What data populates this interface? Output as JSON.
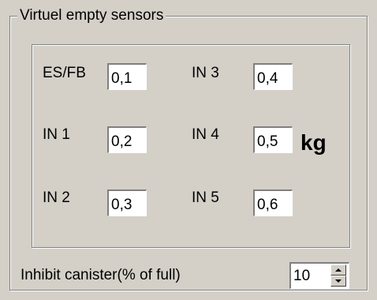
{
  "group": {
    "title": "Virtuel empty sensors"
  },
  "sensors": [
    {
      "label": "ES/FB",
      "value": "0,1"
    },
    {
      "label": "IN 1",
      "value": "0,2"
    },
    {
      "label": "IN 2",
      "value": "0,3"
    },
    {
      "label": "IN 3",
      "value": "0,4"
    },
    {
      "label": "IN 4",
      "value": "0,5"
    },
    {
      "label": "IN 5",
      "value": "0,6"
    }
  ],
  "unit": "kg",
  "inhibit": {
    "label": "Inhibit canister(% of full)",
    "value": "10"
  },
  "icons": {
    "spin_up": "spin-up-arrow-icon",
    "spin_down": "spin-down-arrow-icon"
  }
}
